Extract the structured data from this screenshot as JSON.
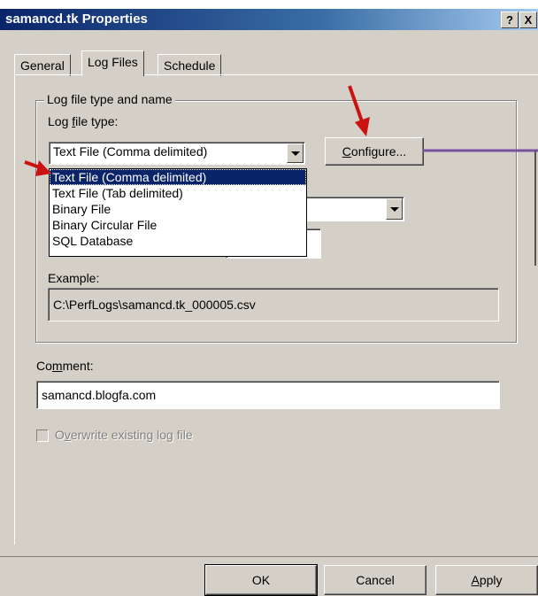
{
  "window": {
    "title": "samancd.tk Properties",
    "help_btn": "?",
    "close_btn": "X"
  },
  "tabs": [
    {
      "label": "General",
      "active": false
    },
    {
      "label": "Log Files",
      "active": true
    },
    {
      "label": "Schedule",
      "active": false
    }
  ],
  "group": {
    "legend": "Log file type and name",
    "type_label_pre": "Log ",
    "type_label_u": "f",
    "type_label_post": "ile type:",
    "type_value": "Text File (Comma delimited)",
    "configure_label_u": "C",
    "configure_label_rest": "onfigure...",
    "dropdown_options": [
      "Text File (Comma delimited)",
      "Text File (Tab delimited)",
      "Binary File",
      "Binary Circular File",
      "SQL Database"
    ],
    "selected_index": 0,
    "example_label": "Example:",
    "example_value": "C:\\PerfLogs\\samancd.tk_000005.csv"
  },
  "comment": {
    "label_pre": "Co",
    "label_u": "m",
    "label_post": "ment:",
    "value": "samancd.blogfa.com"
  },
  "overwrite": {
    "label_u": "v",
    "label_pre": "O",
    "label_post": "erwrite existing log file",
    "checked": false
  },
  "footer": {
    "ok": "OK",
    "cancel": "Cancel",
    "apply_u": "A",
    "apply_rest": "pply"
  },
  "colors": {
    "annotation_arrow": "#cc1111",
    "annotation_line": "#7a4fa0",
    "selection": "#0a246a"
  }
}
